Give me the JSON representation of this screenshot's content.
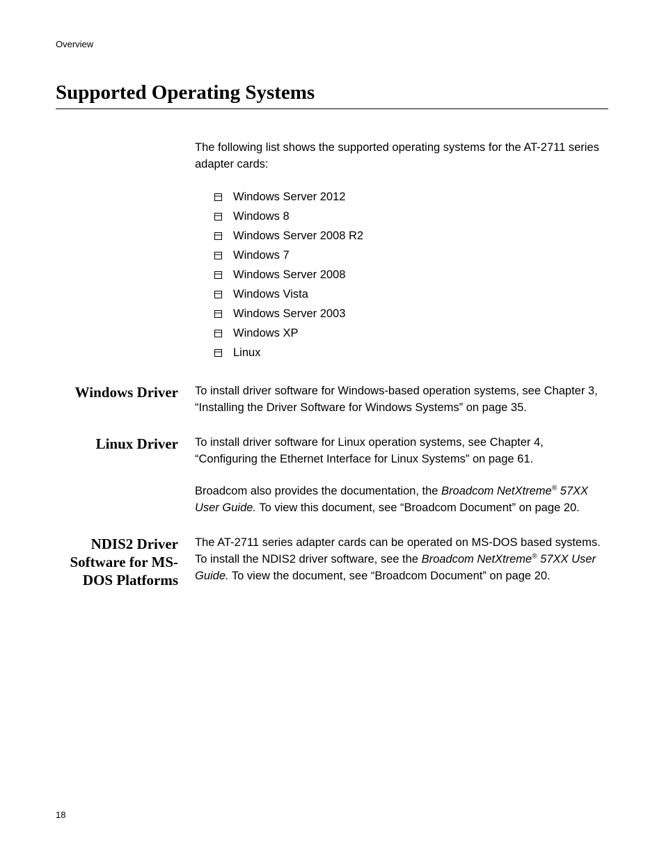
{
  "running_head": "Overview",
  "title": "Supported Operating Systems",
  "intro": "The following list shows the supported operating systems for the AT-2711 series adapter cards:",
  "os_list": [
    "Windows Server 2012",
    "Windows 8",
    "Windows Server 2008 R2",
    "Windows 7",
    "Windows Server 2008",
    "Windows Vista",
    "Windows Server 2003",
    "Windows XP",
    "Linux"
  ],
  "sections": {
    "windows_driver": {
      "heading": "Windows Driver",
      "body": "To install driver software for Windows-based operation systems, see Chapter 3, “Installing the Driver Software for Windows Systems” on page 35."
    },
    "linux_driver": {
      "heading": "Linux Driver",
      "p1": "To install driver software for Linux operation systems, see Chapter 4, “Configuring the Ethernet Interface for Linux Systems” on page 61.",
      "p2_before": "Broadcom also provides the documentation, the ",
      "p2_italic1": "Broadcom NetXtreme",
      "p2_reg": "®",
      "p2_italic2": " 57XX User Guide.",
      "p2_after": " To view this document, see “Broadcom Document” on page 20."
    },
    "ndis2": {
      "heading": "NDIS2 Driver Software for MS-DOS Platforms",
      "before1": "The AT-2711 series adapter cards can be operated on MS-DOS based systems. To install the NDIS2 driver software, see the ",
      "italic1": "Broadcom NetXtreme",
      "reg": "®",
      "italic2": " 57XX User Guide.",
      "after": " To view the document, see “Broadcom Document” on page 20."
    }
  },
  "page_number": "18"
}
